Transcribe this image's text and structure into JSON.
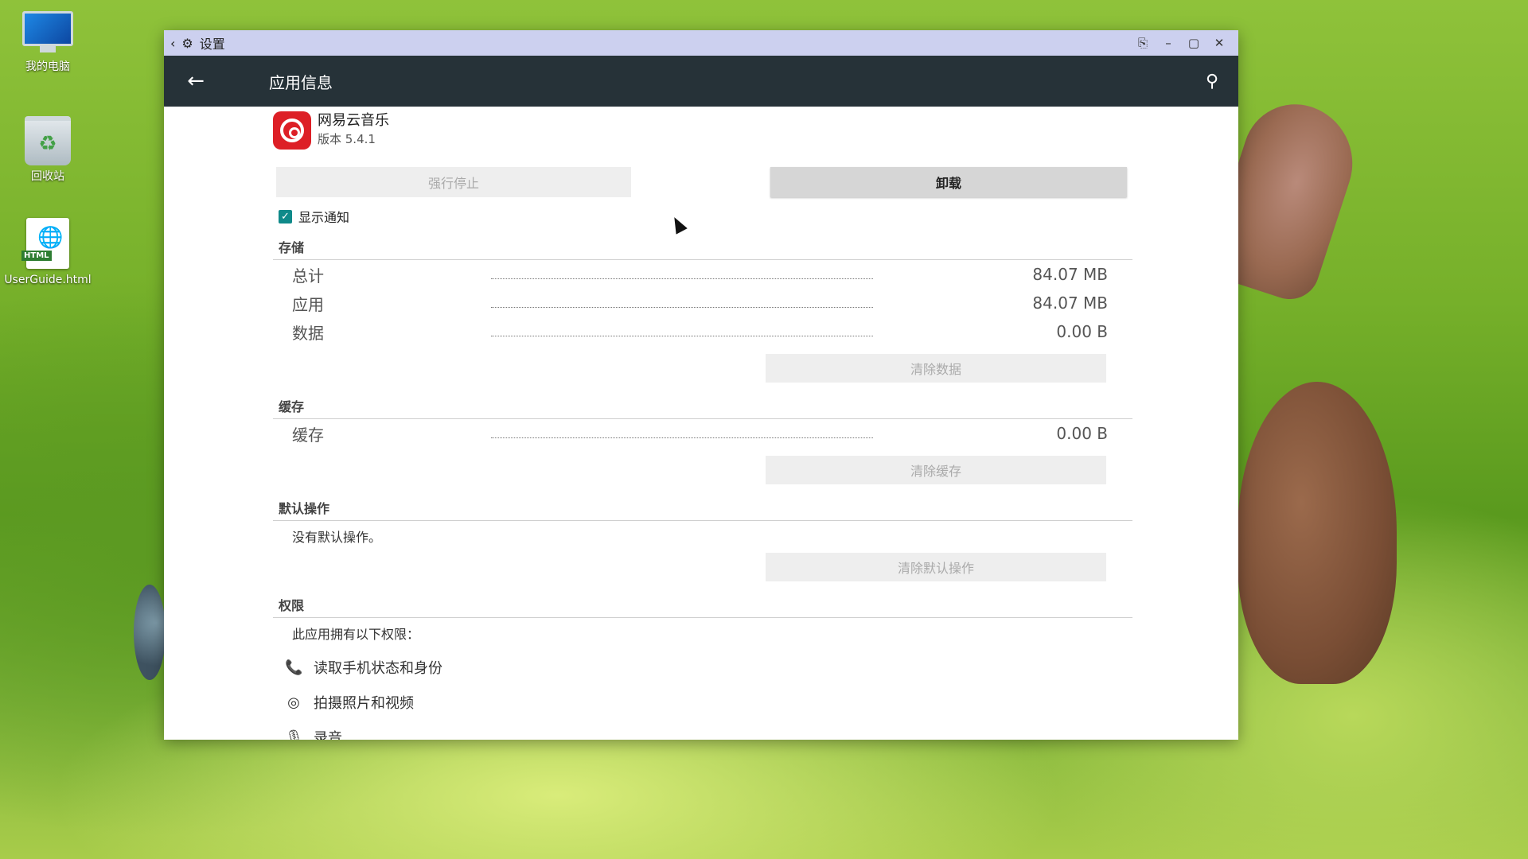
{
  "desktop": {
    "icons": [
      {
        "label": "我的电脑"
      },
      {
        "label": "回收站"
      },
      {
        "label": "UserGuide.html"
      }
    ]
  },
  "window": {
    "titlebar": {
      "back_icon": "chevron-left-icon",
      "app_icon": "settings-gear-icon",
      "title": "设置"
    },
    "appbar": {
      "title": "应用信息"
    },
    "app": {
      "name": "网易云音乐",
      "version": "版本 5.4.1",
      "brand_color": "#dd1f26"
    },
    "buttons": {
      "force_stop": "强行停止",
      "uninstall": "卸载",
      "clear_data": "清除数据",
      "clear_cache": "清除缓存",
      "clear_defaults": "清除默认操作"
    },
    "notification": {
      "label": "显示通知",
      "checked": true
    },
    "storage": {
      "header": "存储",
      "rows": [
        {
          "label": "总计",
          "value": "84.07 MB"
        },
        {
          "label": "应用",
          "value": "84.07 MB"
        },
        {
          "label": "数据",
          "value": "0.00 B"
        }
      ]
    },
    "cache": {
      "header": "缓存",
      "rows": [
        {
          "label": "缓存",
          "value": "0.00 B"
        }
      ]
    },
    "defaults": {
      "header": "默认操作",
      "note": "没有默认操作。"
    },
    "permissions": {
      "header": "权限",
      "note": "此应用拥有以下权限：",
      "items": [
        {
          "icon": "phone-icon",
          "label": "读取手机状态和身份"
        },
        {
          "icon": "camera-icon",
          "label": "拍摄照片和视频"
        },
        {
          "icon": "microphone-icon",
          "label": "录音"
        }
      ]
    },
    "accent_color": "#0f8a8a"
  }
}
